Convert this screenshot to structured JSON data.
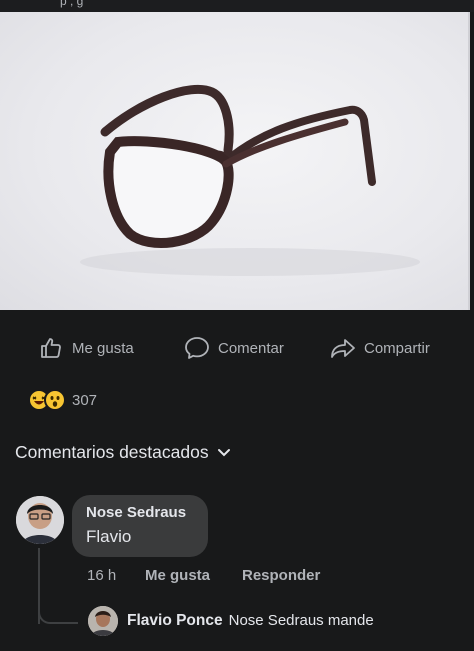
{
  "post": {
    "top_strip_text": "p                    ,                  g"
  },
  "actions": {
    "like_label": "Me gusta",
    "comment_label": "Comentar",
    "share_label": "Compartir"
  },
  "reactions": {
    "count": "307",
    "emojis": [
      "haha-reaction-icon",
      "wow-reaction-icon"
    ]
  },
  "comments": {
    "section_title": "Comentarios destacados",
    "main": {
      "author": "Nose Sedraus",
      "text": "Flavio",
      "time": "16 h",
      "like_label": "Me gusta",
      "reply_label": "Responder"
    },
    "reply": {
      "author": "Flavio Ponce",
      "text": "Nose Sedraus mande"
    }
  },
  "colors": {
    "background": "#18191a",
    "bubble": "#3a3b3c",
    "secondary_text": "#b0b3b8",
    "primary_text": "#e4e6eb"
  }
}
